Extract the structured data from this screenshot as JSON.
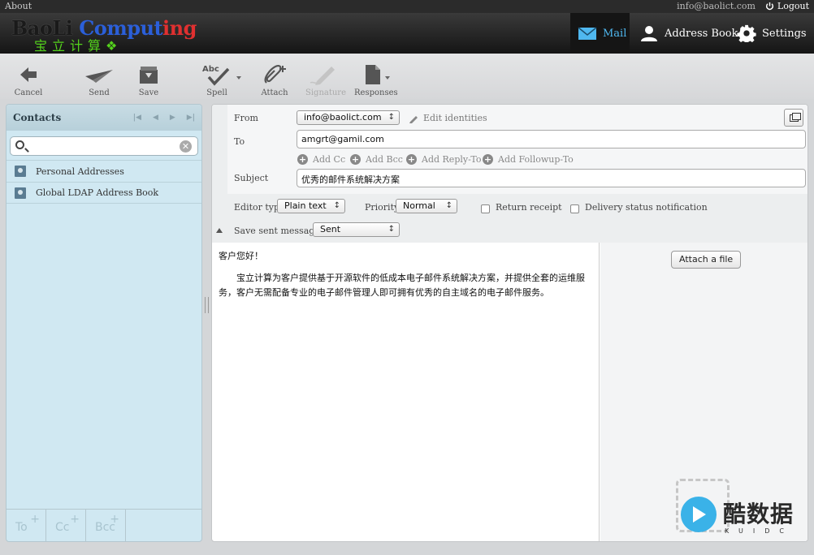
{
  "topbar": {
    "about": "About",
    "email": "info@baolict.com",
    "logout": "Logout"
  },
  "logo": {
    "line1_b": "BaoLi ",
    "line1_c": "Comput",
    "line1_r": "ing",
    "line2": "宝立计算❖"
  },
  "nav": [
    {
      "label": "Mail",
      "icon": "mail-icon",
      "active": true
    },
    {
      "label": "Address Book",
      "icon": "person-icon"
    },
    {
      "label": "Settings",
      "icon": "gear-icon"
    }
  ],
  "toolbar": {
    "cancel": "Cancel",
    "send": "Send",
    "save": "Save",
    "spell": "Spell",
    "attach": "Attach",
    "signature": "Signature",
    "responses": "Responses"
  },
  "contacts": {
    "title": "Contacts",
    "search_placeholder": "",
    "books": [
      "Personal Addresses",
      "Global LDAP Address Book"
    ],
    "footer": [
      "To",
      "Cc",
      "Bcc"
    ]
  },
  "compose": {
    "from_label": "From",
    "from_value": "info@baolict.com",
    "edit_identities": "Edit identities",
    "to_label": "To",
    "to_value": "amgrt@gamil.com",
    "add_links": [
      "Add Cc",
      "Add Bcc",
      "Add Reply-To",
      "Add Followup-To"
    ],
    "subject_label": "Subject",
    "subject_value": "优秀的邮件系统解决方案",
    "editor_type_label": "Editor type",
    "editor_type_value": "Plain text",
    "priority_label": "Priority",
    "priority_value": "Normal",
    "return_receipt": "Return receipt",
    "delivery_status": "Delivery status notification",
    "save_sent_label": "Save sent message in",
    "save_sent_value": "Sent",
    "body_greeting": "客户您好！",
    "body_text": "宝立计算为客户提供基于开源软件的低成本电子邮件系统解决方案，并提供全套的运维服务，客户无需配备专业的电子邮件管理人即可拥有优秀的自主域名的电子邮件服务。",
    "attach_button": "Attach a file"
  },
  "watermark": {
    "cn": "酷数据",
    "en": "KUIDC"
  },
  "colors": {
    "accent": "#4fb8f0",
    "header_bg": "#1a1a1a",
    "contacts_bg": "#d0e8f2",
    "logo_green": "#54d21c",
    "logo_red": "#e03030",
    "logo_blue": "#2b5fd9"
  }
}
